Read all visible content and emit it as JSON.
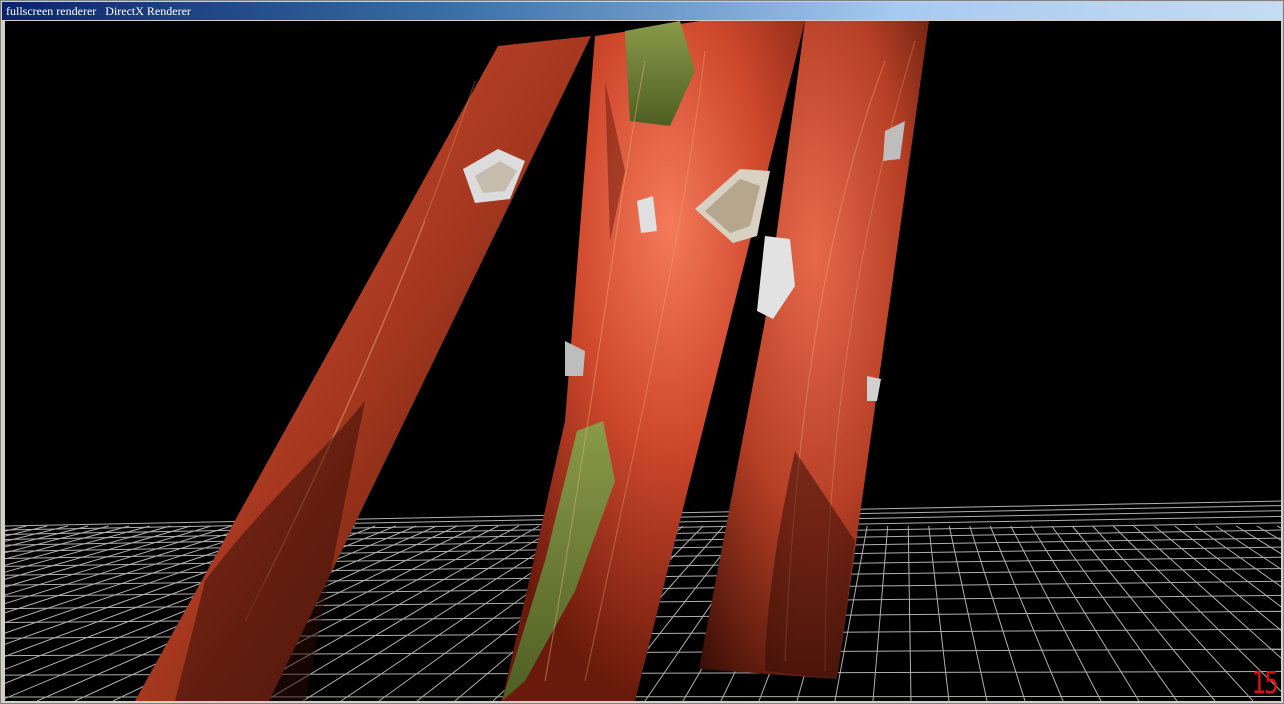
{
  "window": {
    "title": "fullscreen renderer   DirectX Renderer"
  },
  "scene": {
    "floor_grid_color": "#cfcfcf",
    "panel_base_color": "#c8472d",
    "panel_highlight_color": "#f0745a",
    "panel_shadow_color": "#4a1208",
    "grass_color": "#6f7f3a",
    "sky_color": "#000000"
  },
  "hud": {
    "fps": "15"
  }
}
